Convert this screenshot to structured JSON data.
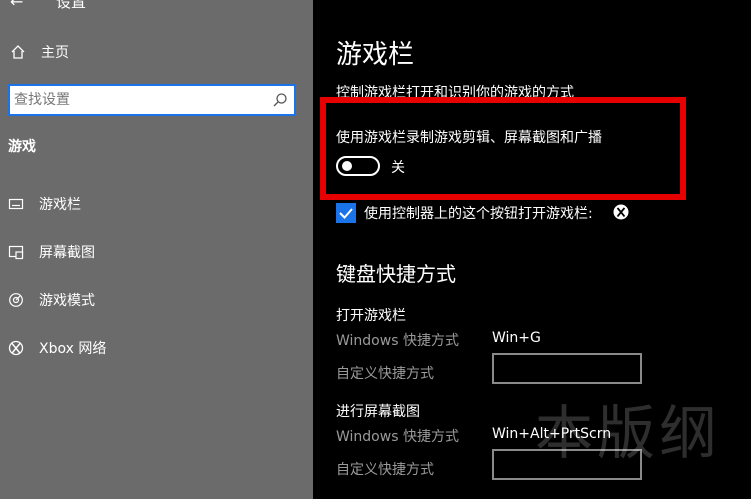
{
  "sidebar": {
    "top_cut_text": "设置",
    "home_label": "主页",
    "search_placeholder": "查找设置",
    "section_title": "游戏",
    "items": [
      {
        "label": "游戏栏",
        "icon": "gamebar-icon"
      },
      {
        "label": "屏幕截图",
        "icon": "screenshot-icon"
      },
      {
        "label": "游戏模式",
        "icon": "gamemode-icon"
      },
      {
        "label": "Xbox 网络",
        "icon": "xbox-icon"
      }
    ]
  },
  "main": {
    "title": "游戏栏",
    "description": "控制游戏栏打开和识别你的游戏的方式",
    "toggle_caption": "使用游戏栏录制游戏剪辑、屏幕截图和广播",
    "toggle_state": "关",
    "checkbox_label": "使用控制器上的这个按钮打开游戏栏:",
    "keyboard_heading": "键盘快捷方式",
    "groups": [
      {
        "title": "打开游戏栏",
        "windows_label": "Windows 快捷方式",
        "windows_value": "Win+G",
        "custom_label": "自定义快捷方式",
        "custom_value": ""
      },
      {
        "title": "进行屏幕截图",
        "windows_label": "Windows 快捷方式",
        "windows_value": "Win+Alt+PrtScrn",
        "custom_label": "自定义快捷方式",
        "custom_value": ""
      }
    ],
    "watermark": "本版纲"
  },
  "colors": {
    "sidebar_bg": "#6b6b6b",
    "main_bg": "#000000",
    "accent": "#1a73e8",
    "highlight": "#e60000"
  }
}
